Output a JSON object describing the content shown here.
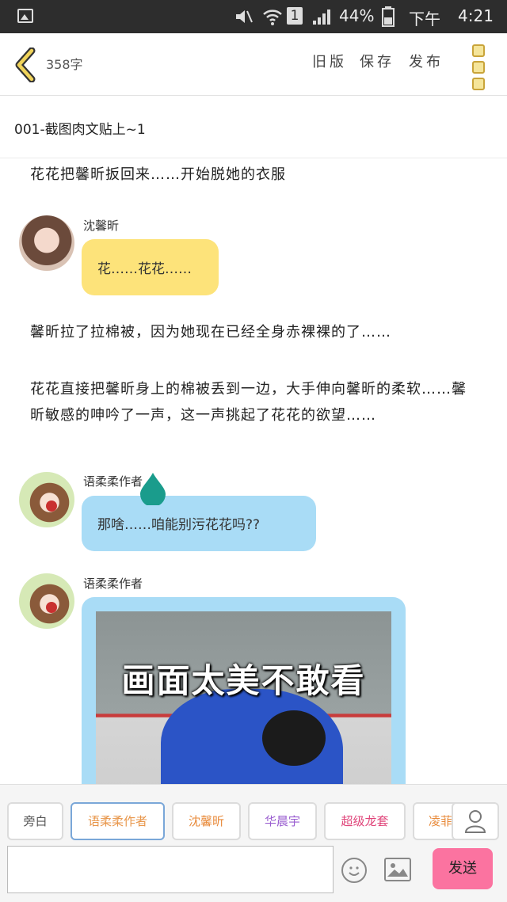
{
  "status": {
    "mute_icon": "mute-icon",
    "wifi_icon": "wifi-icon",
    "sim": "1",
    "battery": "44%",
    "ampm": "下午",
    "time": "4:21"
  },
  "toolbar": {
    "word_count": "358字",
    "old_version": "旧版",
    "save": "保存",
    "publish": "发布"
  },
  "chapter_title": "001-截图肉文贴上~1",
  "story": {
    "p1": "花花把馨昕扳回来……开始脱她的衣服",
    "m1": {
      "name": "沈馨昕",
      "text": "花……花花……"
    },
    "p2": "馨昕拉了拉棉被，因为她现在已经全身赤裸裸的了……",
    "p3": "花花直接把馨昕身上的棉被丢到一边，大手伸向馨昕的柔软……馨昕敏感的呻吟了一声，这一声挑起了花花的欲望……",
    "m2": {
      "name": "语柔柔作者",
      "text": "那啥……咱能别污花花吗??"
    },
    "m3": {
      "name": "语柔柔作者",
      "image_caption": "画面太美不敢看"
    }
  },
  "roles": [
    {
      "label": "旁白",
      "color": "#555555"
    },
    {
      "label": "语柔柔作者",
      "color": "#e8964a"
    },
    {
      "label": "沈馨昕",
      "color": "#e88a3a"
    },
    {
      "label": "华晨宇",
      "color": "#9a5ed0"
    },
    {
      "label": "超级龙套",
      "color": "#e0457a"
    },
    {
      "label": "凌菲",
      "color": "#e88a3a"
    }
  ],
  "send_label": "发送",
  "colors": {
    "yellow_bubble": "#fde37a",
    "blue_bubble": "#a9dcf6",
    "send": "#fb73a0",
    "teal": "#1a9c8c"
  }
}
